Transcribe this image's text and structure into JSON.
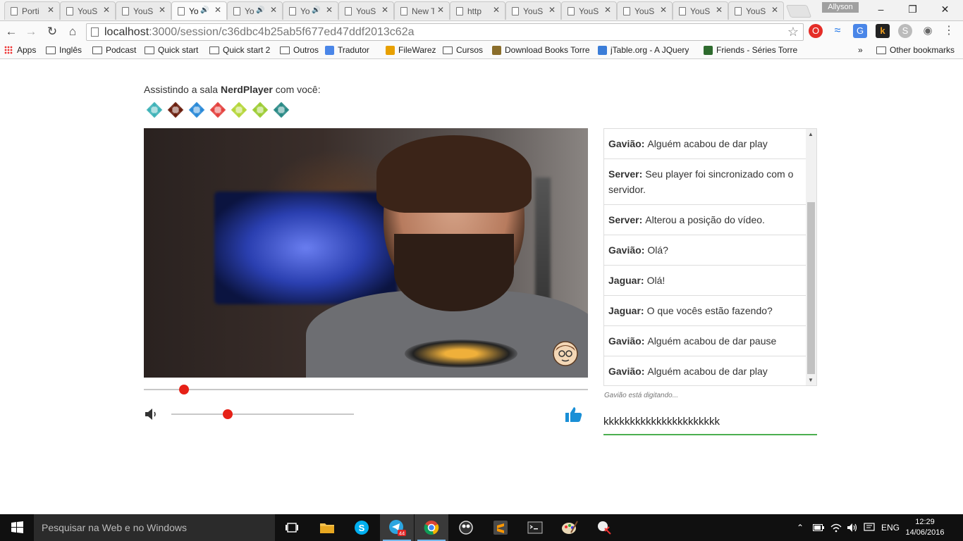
{
  "browser": {
    "tabs": [
      {
        "label": "Porti",
        "audio": false
      },
      {
        "label": "YouS",
        "audio": false
      },
      {
        "label": "YouS",
        "audio": false
      },
      {
        "label": "Yo",
        "audio": true,
        "active": true
      },
      {
        "label": "Yo",
        "audio": true
      },
      {
        "label": "Yo",
        "audio": true
      },
      {
        "label": "YouS",
        "audio": false
      },
      {
        "label": "New Tab",
        "audio": false
      },
      {
        "label": "http",
        "audio": false
      },
      {
        "label": "YouS",
        "audio": false
      },
      {
        "label": "YouS",
        "audio": false
      },
      {
        "label": "YouS",
        "audio": false
      },
      {
        "label": "YouS",
        "audio": false
      },
      {
        "label": "YouS",
        "audio": false
      }
    ],
    "profile_name": "Allyson",
    "url_host": "localhost",
    "url_rest": ":3000/session/c36dbc4b25ab5f677ed47ddf2013c62a",
    "bookmarks": [
      {
        "label": "Apps",
        "icon": "apps-icon"
      },
      {
        "label": "Inglês",
        "icon": "folder-icon"
      },
      {
        "label": "Podcast",
        "icon": "folder-icon"
      },
      {
        "label": "Quick start",
        "icon": "folder-icon"
      },
      {
        "label": "Quick start 2",
        "icon": "folder-icon"
      },
      {
        "label": "Outros",
        "icon": "folder-icon"
      },
      {
        "label": "Tradutor",
        "icon": "translate-icon"
      },
      {
        "label": "FileWarez",
        "icon": "filewarez-icon"
      },
      {
        "label": "Cursos",
        "icon": "folder-icon"
      },
      {
        "label": "Download Books Torre",
        "icon": "shield-icon"
      },
      {
        "label": "jTable.org - A JQuery",
        "icon": "jtable-icon"
      },
      {
        "label": "Friends - Séries Torre",
        "icon": "friends-icon"
      }
    ],
    "bookmarks_overflow": "»",
    "other_bookmarks": "Other bookmarks"
  },
  "room": {
    "prefix": "Assistindo a sala ",
    "name": "NerdPlayer",
    "suffix": " com você:",
    "avatar_colors": [
      "#3fb3b8",
      "#6b1f0f",
      "#2a8ad8",
      "#e4423f",
      "#b5d63a",
      "#9ccc33",
      "#2a8a86"
    ]
  },
  "player": {
    "seek_progress": 0.09,
    "volume": 0.31
  },
  "chat": {
    "messages": [
      {
        "author": "Gavião:",
        "text": "Alguém acabou de dar play"
      },
      {
        "author": "Server:",
        "text": "Seu player foi sincronizado com o servidor."
      },
      {
        "author": "Server:",
        "text": "Alterou a posição do vídeo."
      },
      {
        "author": "Gavião:",
        "text": "Olá?"
      },
      {
        "author": "Jaguar:",
        "text": "Olá!"
      },
      {
        "author": "Jaguar:",
        "text": "O que vocês estão fazendo?"
      },
      {
        "author": "Gavião:",
        "text": "Alguém acabou de dar pause"
      },
      {
        "author": "Gavião:",
        "text": "Alguém acabou de dar play"
      }
    ],
    "typing_status": "Gavião está digitando...",
    "input_value": "kkkkkkkkkkkkkkkkkkkkkk"
  },
  "taskbar": {
    "search_placeholder": "Pesquisar na Web e no Windows",
    "telegram_badge": "44",
    "language": "ENG",
    "time": "12:29",
    "date": "14/06/2016"
  },
  "colors": {
    "accent_red": "#e62117",
    "like_blue": "#1a8fd6",
    "input_underline": "#4caf50"
  }
}
